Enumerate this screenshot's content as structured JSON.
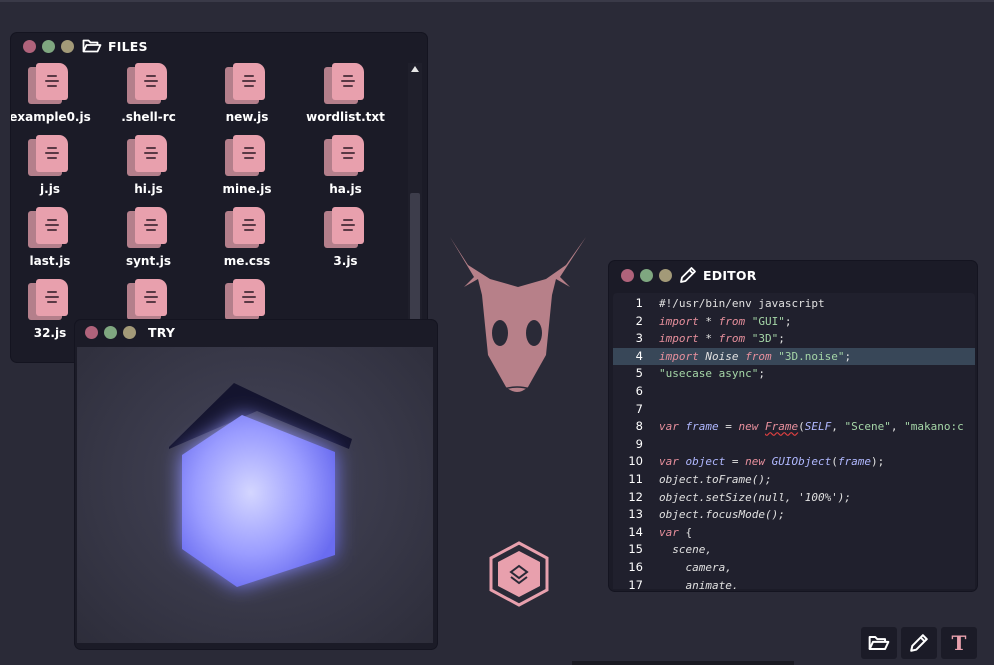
{
  "files_window": {
    "title": "FILES",
    "items": [
      {
        "name": "example0.js"
      },
      {
        "name": ".shell-rc"
      },
      {
        "name": "new.js"
      },
      {
        "name": "wordlist.txt"
      },
      {
        "name": "j.js"
      },
      {
        "name": "hi.js"
      },
      {
        "name": "mine.js"
      },
      {
        "name": "ha.js"
      },
      {
        "name": "last.js"
      },
      {
        "name": "synt.js"
      },
      {
        "name": "me.css"
      },
      {
        "name": "3.js"
      },
      {
        "name": "32.js"
      },
      {
        "name": ""
      },
      {
        "name": ""
      }
    ]
  },
  "try_window": {
    "title": "TRY"
  },
  "editor_window": {
    "title": "EDITOR",
    "active_line": 4,
    "lines": [
      "#!/usr/bin/env javascript",
      "import * from \"GUI\";",
      "import * from \"3D\";",
      "import Noise from \"3D.noise\";",
      "\"usecase async\";",
      "",
      "",
      "var frame = new Frame(SELF, \"Scene\", \"makano:c",
      "",
      "var object = new GUIObject(frame);",
      "object.toFrame();",
      "object.setSize(null, '100%');",
      "object.focusMode();",
      "var {",
      "  scene,",
      "    camera,",
      "    animate,"
    ]
  },
  "dock": {
    "files_icon": "folder-open-icon",
    "editor_icon": "pencil-icon",
    "text_label": "T"
  },
  "colors": {
    "background": "#2a2a37",
    "window": "#1b1b27",
    "accent_pink": "#e8a0ad",
    "dot_red": "#b0637b",
    "dot_green": "#7fa780",
    "dot_tan": "#a39a78",
    "cube_glow": "#6a6cff"
  }
}
